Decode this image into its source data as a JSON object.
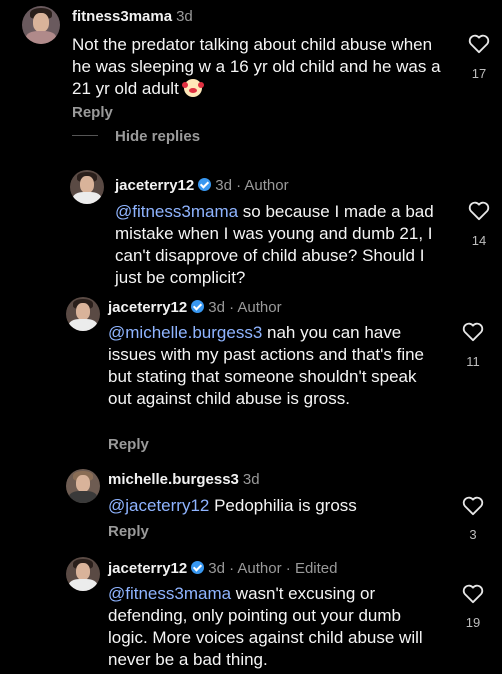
{
  "comments": [
    {
      "username": "fitness3mama",
      "meta": "3d",
      "text": "Not the predator talking about child abuse when he was sleeping w a 16 yr old child and he was a 21 yr old adult",
      "likes": "17",
      "reply_label": "Reply",
      "hide_replies_label": "Hide replies"
    },
    {
      "username": "jaceterry12",
      "meta": "3d · Author",
      "mention": "@fitness3mama",
      "text": " so because I made a bad mistake when I was young and dumb 21, I can't disapprove of child abuse?  Should I just be complicit?",
      "likes": "14"
    },
    {
      "username": "jaceterry12",
      "meta": "3d · Author",
      "mention": "@michelle.burgess3",
      "text": " nah you can have issues with my past actions and that's fine but stating that someone shouldn't speak out against child abuse is gross.",
      "likes": "11",
      "reply_label": "Reply"
    },
    {
      "username": "michelle.burgess3",
      "meta": "3d",
      "mention": "@jaceterry12",
      "text": "  Pedophilia is gross",
      "likes": "3",
      "reply_label": "Reply"
    },
    {
      "username": "jaceterry12",
      "meta": "3d · Author · Edited",
      "mention": "@fitness3mama",
      "text": " wasn't excusing or defending, only pointing out your dumb logic.  More voices against child abuse will never be a bad thing.",
      "likes": "19"
    }
  ],
  "icons": {
    "like": "heart-icon",
    "verified": "verified-badge-icon",
    "emoji": "clown-face-emoji"
  },
  "colors": {
    "background": "#000000",
    "mention": "#8fb4ff",
    "verified": "#3897f0",
    "muted": "#9a9a9a"
  }
}
